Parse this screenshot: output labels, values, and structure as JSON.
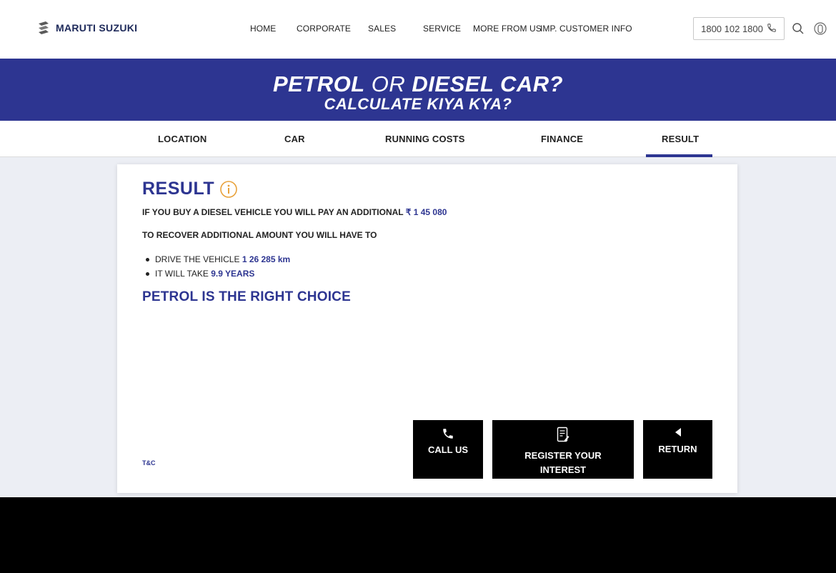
{
  "header": {
    "brand": "MARUTI SUZUKI",
    "nav": [
      "HOME",
      "CORPORATE",
      "SALES",
      "SERVICE",
      "MORE FROM US",
      "IMP. CUSTOMER INFO"
    ],
    "phone": "1800 102 1800",
    "icons": [
      "phone-icon",
      "search-icon",
      "user-icon"
    ]
  },
  "banner": {
    "line1_a": "PETROL",
    "line1_or": " OR ",
    "line1_b": "DIESEL CAR?",
    "line2": "CALCULATE KIYA KYA?"
  },
  "steps": {
    "items": [
      "LOCATION",
      "CAR",
      "RUNNING COSTS",
      "FINANCE",
      "RESULT"
    ],
    "active": "RESULT"
  },
  "result": {
    "title": "RESULT",
    "line1_prefix": "IF YOU BUY A DIESEL VEHICLE YOU WILL PAY AN ADDITIONAL ",
    "line1_amount": "₹ 1 45 080",
    "line2": "TO RECOVER ADDITIONAL AMOUNT YOU WILL HAVE TO",
    "bullet1_prefix": "DRIVE THE VEHICLE ",
    "bullet1_value": "1 26 285 km",
    "bullet2_prefix": "IT WILL TAKE ",
    "bullet2_value": "9.9 YEARS",
    "choice": "PETROL IS THE RIGHT CHOICE",
    "tc": "T&C"
  },
  "buttons": {
    "call": "CALL US",
    "register": "REGISTER YOUR INTEREST",
    "return": "RETURN"
  },
  "colors": {
    "brand_blue": "#2d3591",
    "info_orange": "#e8a13a",
    "content_bg": "#eceef4"
  }
}
